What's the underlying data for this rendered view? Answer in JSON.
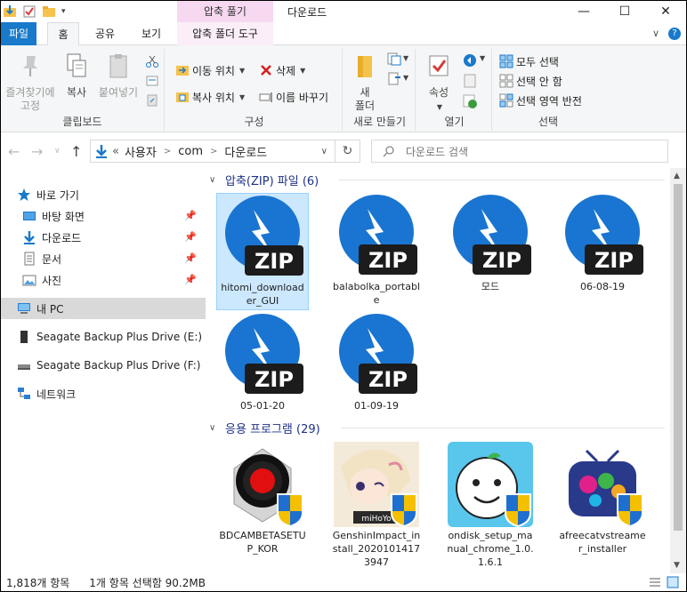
{
  "window": {
    "title": "다운로드",
    "context_tab_header": "압축 풀기",
    "controls": {
      "minimize": "—",
      "maximize": "☐",
      "close": "✕"
    }
  },
  "tabs": {
    "file": "파일",
    "home": "홈",
    "share": "공유",
    "view": "보기",
    "compressed_tools": "압축 폴더 도구",
    "collapse_caret": "∨",
    "help": "?"
  },
  "ribbon": {
    "clipboard": {
      "label": "클립보드",
      "pin": "즐겨찾기에\n고정",
      "copy": "복사",
      "paste": "붙여넣기"
    },
    "organize": {
      "label": "구성",
      "move_to": "이동 위치",
      "copy_to": "복사 위치",
      "delete": "삭제",
      "rename": "이름 바꾸기"
    },
    "new": {
      "label": "새로 만들기",
      "new_folder": "새\n폴더"
    },
    "open": {
      "label": "열기",
      "properties": "속성"
    },
    "select": {
      "label": "선택",
      "select_all": "모두 선택",
      "select_none": "선택 안 함",
      "invert": "선택 영역 반전"
    }
  },
  "address": {
    "prefix": "«",
    "crumbs": [
      "사용자",
      "com",
      "다운로드"
    ],
    "separator": ">",
    "search_placeholder": "다운로드 검색"
  },
  "nav": {
    "quick_access": "바로 가기",
    "desktop": "바탕 화면",
    "downloads": "다운로드",
    "documents": "문서",
    "pictures": "사진",
    "this_pc": "내 PC",
    "drive_e": "Seagate Backup Plus Drive (E:)",
    "drive_f": "Seagate Backup Plus Drive (F:)",
    "network": "네트워크"
  },
  "groups": {
    "zip": "압축(ZIP) 파일 (6)",
    "apps": "응용 프로그램 (29)"
  },
  "zip_files": [
    "hitomi_downloader_GUI",
    "balabolka_portable",
    "모드",
    "06-08-19",
    "05-01-20",
    "01-09-19"
  ],
  "zip_badge": "ZIP",
  "apps": [
    "BDCAMBETASETUP_KOR",
    "GenshinImpact_install_20201014173947",
    "ondisk_setup_manual_chrome_1.0.1.6.1",
    "afreecatvstreamer_installer"
  ],
  "genshin_logo": "miHoYo",
  "status": {
    "item_count": "1,818개 항목",
    "selection": "1개 항목 선택함 90.2MB"
  },
  "colors": {
    "accent": "#1979ca",
    "context_tab": "#f6d9f0",
    "selection": "#cce8ff",
    "group_header": "#1e3287"
  }
}
